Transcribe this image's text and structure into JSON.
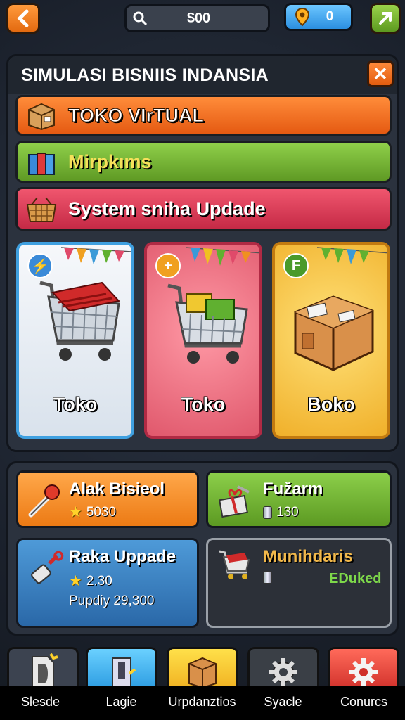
{
  "topbar": {
    "back_icon": "chevron-left",
    "money_icon": "search-icon",
    "money_value": "$00",
    "gem_icon": "map-pin-icon",
    "gem_value": "0",
    "share_icon": "arrow-up-right-icon"
  },
  "panel": {
    "title": "SIMULASI BISNIIS INDANSIA",
    "close_icon": "close-icon",
    "rows": [
      {
        "label": "TOKO VIrTUAL",
        "icon": "box-icon"
      },
      {
        "label": "Mirpkıms",
        "icon": "books-icon"
      },
      {
        "label": "System sniha Updade",
        "icon": "basket-icon"
      }
    ],
    "cards": [
      {
        "label": "Toko",
        "badge": "⚡",
        "icon": "cart-red-icon"
      },
      {
        "label": "Toko",
        "badge": "+",
        "icon": "cart-goods-icon"
      },
      {
        "label": "Boko",
        "badge": "F",
        "icon": "cardboard-box-icon"
      }
    ]
  },
  "tiles": [
    {
      "name": "Alak Bisieol",
      "value": "5030",
      "value_icon": "star-icon",
      "icon": "brush-icon"
    },
    {
      "name": "Fužarm",
      "value": "130",
      "value_icon": "can-icon",
      "icon": "gift-icon"
    },
    {
      "name": "Raka Uppade",
      "value": "2.30",
      "value_icon": "star-icon",
      "extra": "Pupdiy 29,300",
      "icon": "tool-icon"
    },
    {
      "name": "Munihdaris",
      "value": "",
      "value_icon": "can-icon",
      "status": "EDuked",
      "icon": "cart-small-icon"
    }
  ],
  "nav": [
    {
      "label": "Slesde",
      "icon": "document-icon"
    },
    {
      "label": "Lagie",
      "icon": "door-icon"
    },
    {
      "label": "Urpdanztios",
      "icon": "package-icon"
    },
    {
      "label": "Syacle",
      "icon": "gear-icon"
    },
    {
      "label": "Conurcs",
      "icon": "gear-icon"
    }
  ],
  "colors": {
    "orange": "#e55a12",
    "green": "#5f9a24",
    "pink": "#c52a46",
    "blue": "#2a68a8",
    "yellow": "#f0b02a"
  }
}
